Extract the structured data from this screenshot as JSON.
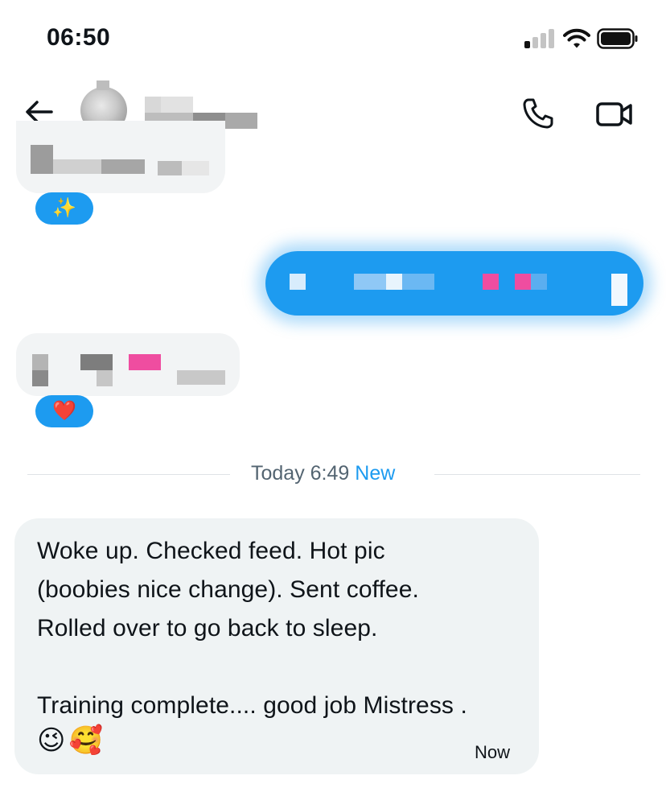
{
  "status_bar": {
    "time": "06:50"
  },
  "header": {
    "back_icon": "arrow-left-icon",
    "call_icon": "phone-icon",
    "video_icon": "video-camera-icon"
  },
  "messages": {
    "reaction_1": "✨",
    "reaction_2": "❤️"
  },
  "divider": {
    "label": "Today 6:49",
    "new_label": "New"
  },
  "latest_message": {
    "lines": [
      "Woke up. Checked feed. Hot pic",
      "(boobies nice change). Sent coffee.",
      "Rolled over to go back to sleep.",
      "",
      "Training complete.... good job Mistress ."
    ],
    "emojis": "😉🥰",
    "time": "Now"
  },
  "colors": {
    "accent": "#1d9bf0",
    "bubble_gray": "#eff3f4",
    "text": "#0f1419",
    "muted": "#536471"
  }
}
